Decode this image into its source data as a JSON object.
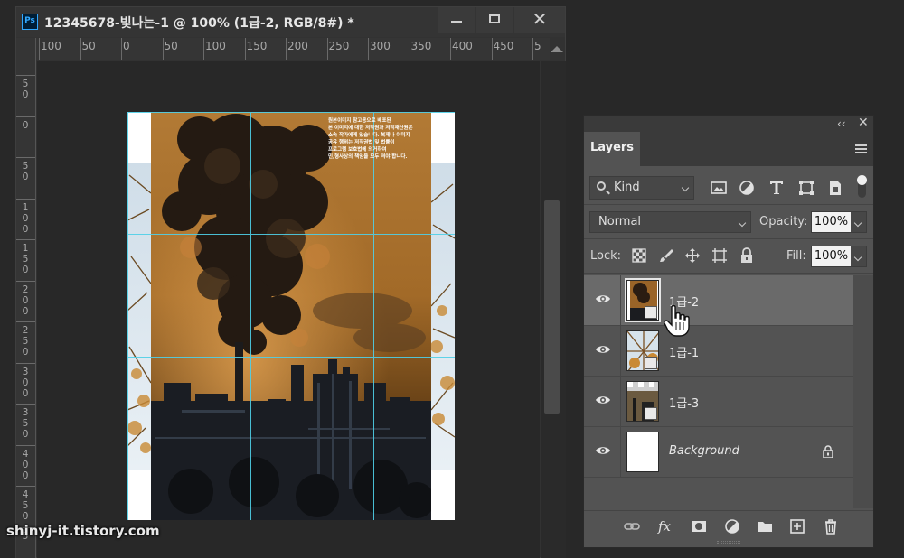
{
  "document": {
    "title": "12345678-빛나는-1 @ 100% (1급-2, RGB/8#) *",
    "app_icon": "Ps",
    "ruler_h_ticks": [
      "100",
      "50",
      "0",
      "50",
      "100",
      "150",
      "200",
      "250",
      "300",
      "350",
      "400",
      "450",
      "5"
    ],
    "ruler_v_ticks": [
      [
        "5",
        "0"
      ],
      [
        "0"
      ],
      [
        "5",
        "0"
      ],
      [
        "1",
        "0",
        "0"
      ],
      [
        "1",
        "5",
        "0"
      ],
      [
        "2",
        "0",
        "0"
      ],
      [
        "2",
        "5",
        "0"
      ],
      [
        "3",
        "0",
        "0"
      ],
      [
        "3",
        "5",
        "0"
      ],
      [
        "4",
        "0",
        "0"
      ],
      [
        "4",
        "5",
        "0"
      ],
      [
        "5"
      ]
    ],
    "overlay_text": "원본이미지 참고용으로 배포된\n본 이미지에 대한 저작권과 저작재산권은\n소속 작가에게 있습니다. 복제나 이미지\n공유 행위는 저작권법 및 법률이\n프로그램 보호법에 의거하여\n민,형사상의 책임을 모두 져야 합니다."
  },
  "watermark": "shinyj-it.tistory.com",
  "layers_panel": {
    "tab": "Layers",
    "filter": {
      "kind_label": "Kind"
    },
    "blend_mode": "Normal",
    "opacity_label": "Opacity:",
    "opacity_value": "100%",
    "lock_label": "Lock:",
    "fill_label": "Fill:",
    "fill_value": "100%",
    "layers": [
      {
        "name": "1급-2",
        "selected": true,
        "type": "smart-object"
      },
      {
        "name": "1급-1",
        "selected": false,
        "type": "smart-object"
      },
      {
        "name": "1급-3",
        "selected": false,
        "type": "smart-object"
      },
      {
        "name": "Background",
        "selected": false,
        "type": "background",
        "locked": true
      }
    ],
    "footer_fx": "fx"
  },
  "colors": {
    "accent": "#31a8ff",
    "guide": "#4fd0e8"
  }
}
